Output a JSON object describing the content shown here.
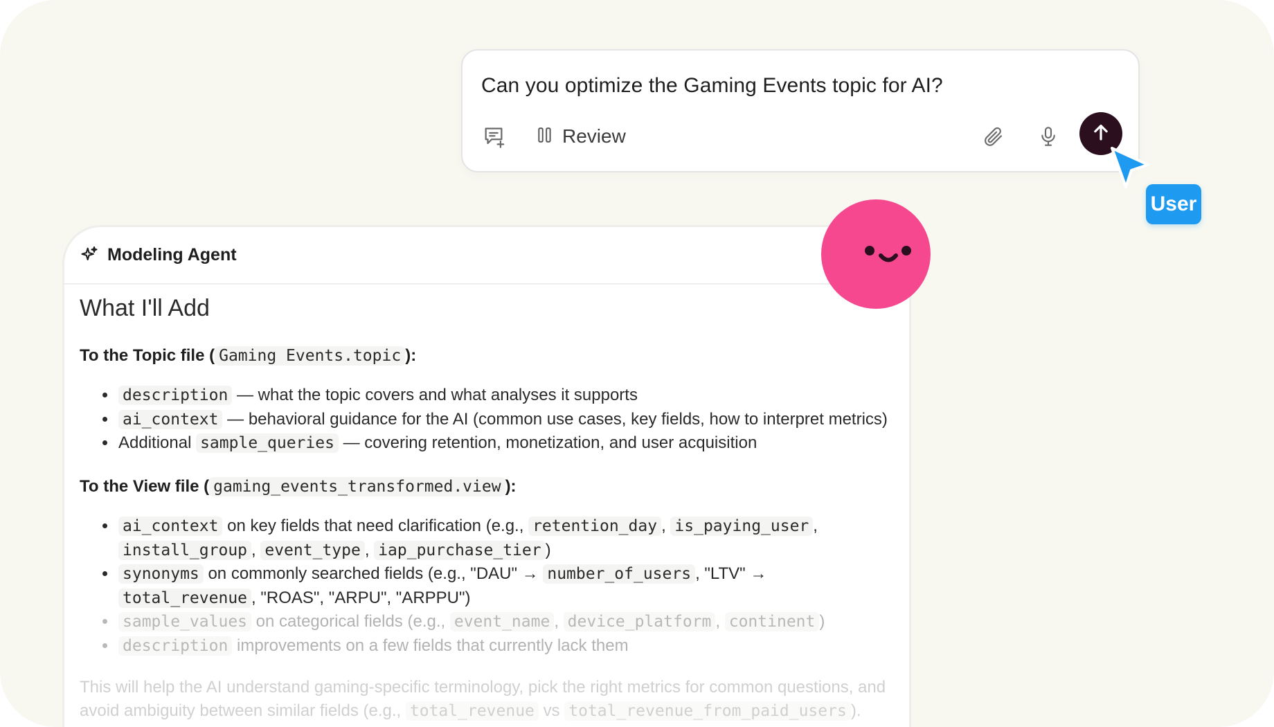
{
  "composer": {
    "prompt": "Can you optimize the Gaming Events topic for AI?",
    "review_label": "Review",
    "icons": {
      "new_chat": "chat-add-icon",
      "review": "columns-icon",
      "attach": "paperclip-icon",
      "mic": "microphone-icon",
      "send": "arrow-up-icon"
    }
  },
  "cursor": {
    "tag": "User",
    "color": "#1e9bf0"
  },
  "agent": {
    "title": "Modeling Agent",
    "heading": "What I'll Add",
    "topic_section": {
      "prefix": "To the Topic file (",
      "file": "Gaming Events.topic",
      "suffix": "):",
      "items": [
        {
          "code": "description",
          "text": " — what the topic covers and what analyses it supports"
        },
        {
          "code": "ai_context",
          "text": " — behavioral guidance for the AI (common use cases, key fields, how to interpret metrics)"
        },
        {
          "lead": "Additional ",
          "code": "sample_queries",
          "text": " — covering retention, monetization, and user acquisition"
        }
      ]
    },
    "view_section": {
      "prefix": "To the View file (",
      "file": "gaming_events_transformed.view",
      "suffix": "):",
      "item1": {
        "code": "ai_context",
        "text": " on key fields that need clarification (e.g., ",
        "c1": "retention_day",
        "c2": "is_paying_user",
        "c3": "install_group",
        "c4": "event_type",
        "c5": "iap_purchase_tier",
        "sep": ", ",
        "end": ")"
      },
      "item2": {
        "code": "synonyms",
        "text": " on commonly searched fields (e.g., \"DAU\" → ",
        "c1": "number_of_users",
        "mid": ", \"LTV\" → ",
        "c2": "total_revenue",
        "end": ", \"ROAS\", \"ARPU\", \"ARPPU\")"
      },
      "item3": {
        "code": "sample_values",
        "text": " on categorical fields (e.g., ",
        "c1": "event_name",
        "c2": "device_platform",
        "c3": "continent",
        "sep": ", ",
        "end": ")"
      },
      "item4": {
        "code": "description",
        "text": " improvements on a few fields that currently lack them"
      }
    },
    "summary": {
      "text": "This will help the AI understand gaming-specific terminology, pick the right metrics for common questions, and avoid ambiguity between similar fields (e.g., ",
      "c1": "total_revenue",
      "mid": " vs ",
      "c2": "total_revenue_from_paid_users",
      "end": ")."
    }
  },
  "colors": {
    "background": "#f8f8f1",
    "send_button": "#2c0f1f",
    "smiley": "#f5488f"
  }
}
